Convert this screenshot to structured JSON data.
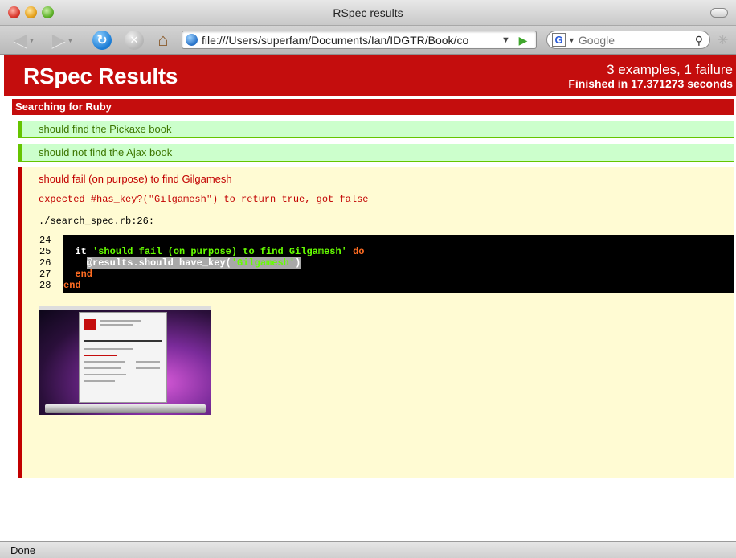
{
  "window": {
    "title": "RSpec results"
  },
  "toolbar": {
    "url": "file:///Users/superfam/Documents/Ian/IDGTR/Book/co",
    "search_placeholder": "Google"
  },
  "report": {
    "title": "RSpec Results",
    "summary": "3 examples, 1 failure",
    "duration_prefix": "Finished in ",
    "duration_value": "17.371273 seconds",
    "colors": {
      "header": "#c40d0d",
      "passed_bg": "#ccffcc",
      "passed_border": "#65c400",
      "failed_bg": "#fffbd3",
      "failed_border": "#c20000"
    },
    "group": {
      "title": "Searching for Ruby",
      "passed": [
        "should find the Pickaxe book",
        "should not find the Ajax book"
      ],
      "failed": {
        "description": "should fail (on purpose) to find Gilgamesh",
        "message": "expected #has_key?(\"Gilgamesh\") to return true, got false",
        "backtrace": "./search_spec.rb:26:",
        "code": {
          "line_numbers": [
            "24",
            "25",
            "26",
            "27",
            "28"
          ],
          "line25": {
            "indent": "  ",
            "keyword_it": "it",
            "string": "'should fail (on purpose) to find Gilgamesh'",
            "keyword_do": "do"
          },
          "line26": {
            "indent": "    ",
            "before": "@results.should have_key(",
            "string": "'Gilgamesh'",
            "after": ")"
          },
          "line27": {
            "indent": "  ",
            "keyword": "end"
          },
          "line28": {
            "keyword": "end"
          }
        }
      }
    }
  },
  "status": {
    "text": "Done"
  }
}
